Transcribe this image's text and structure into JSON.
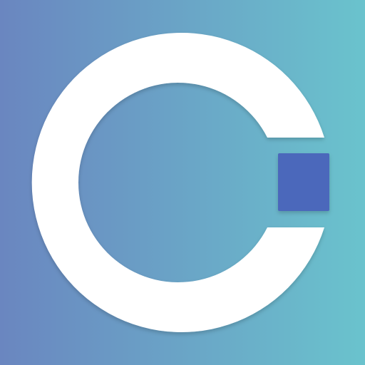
{
  "app_icon": {
    "logo": {
      "icon_name": "c-ring-logo-icon",
      "ring_color": "#ffffff",
      "accent_color": "#4b67bb"
    },
    "background": {
      "gradient_start_color": "#6a86c0",
      "gradient_end_color": "#6ac3cd"
    }
  }
}
